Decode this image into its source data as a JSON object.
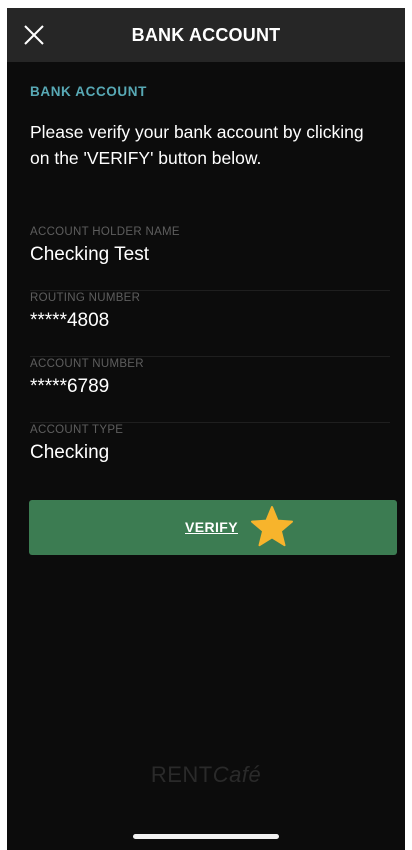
{
  "header": {
    "title": "BANK ACCOUNT",
    "close_icon": "close-icon"
  },
  "content": {
    "section_label": "BANK ACCOUNT",
    "instructions": "Please verify your bank account by clicking on the 'VERIFY' button below."
  },
  "fields": [
    {
      "label": "ACCOUNT HOLDER NAME",
      "value": "Checking Test"
    },
    {
      "label": "ROUTING NUMBER",
      "value": "*****4808"
    },
    {
      "label": "ACCOUNT NUMBER",
      "value": "*****6789"
    },
    {
      "label": "ACCOUNT TYPE",
      "value": "Checking"
    }
  ],
  "verify_button": {
    "label": "VERIFY",
    "icon": "star-icon"
  },
  "brand": {
    "rent": "RENT",
    "cafe": "Café"
  },
  "colors": {
    "background": "#0c0c0c",
    "header": "#262626",
    "section_label": "#58a9b5",
    "button": "#3c7c52",
    "star": "#f7b42c"
  }
}
